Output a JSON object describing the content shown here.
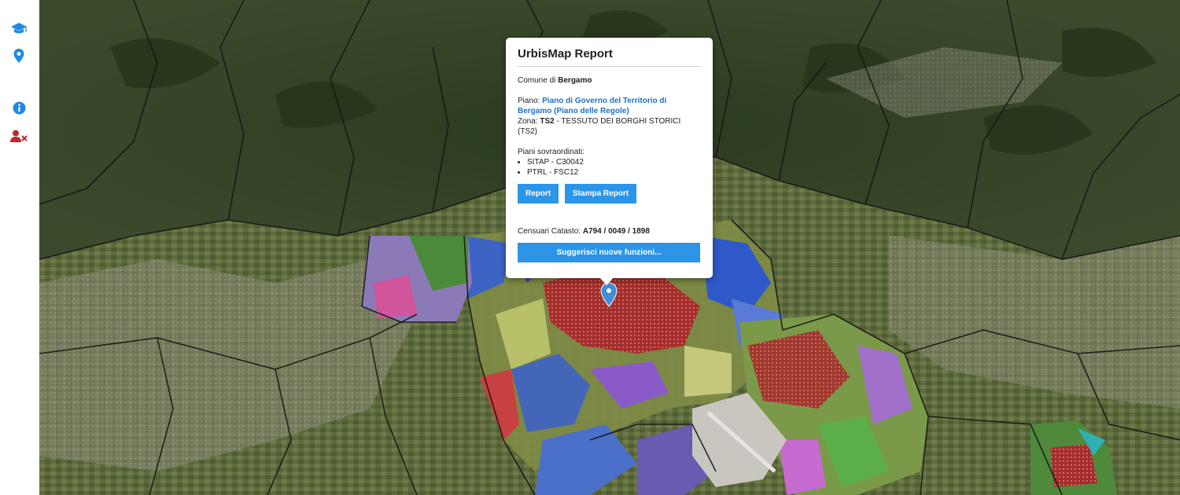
{
  "sidebar": {
    "items": [
      {
        "icon": "graduation-cap-icon",
        "color": "#1e88e5"
      },
      {
        "icon": "map-marker-icon",
        "color": "#1e88e5"
      },
      {
        "icon": "info-circle-icon",
        "color": "#1e88e5"
      },
      {
        "icon": "user-remove-icon",
        "color": "#c0282d"
      }
    ]
  },
  "popup": {
    "title": "UrbisMap Report",
    "comune_prefix": "Comune di",
    "comune_name": "Bergamo",
    "piano_label": "Piano:",
    "piano_link": "Piano di Governo del Territorio di Bergamo (Piano delle Regole)",
    "zona_label": "Zona:",
    "zona_code": "TS2",
    "zona_desc": "- TESSUTO DEI BORGHI STORICI (TS2)",
    "sovraordinati_label": "Piani sovraordinati:",
    "sovraordinati": [
      "SITAP - C30042",
      "PTRL - FSC12"
    ],
    "report_button": "Report",
    "stampa_button": "Stampa Report",
    "catasto_label": "Censuari Catasto:",
    "catasto_value": "A794 / 0049 / 1898",
    "suggest_button": "Suggerisci nuove funzioni..."
  },
  "colors": {
    "accent": "#2c95e8",
    "link": "#1a73c9",
    "marker": "#3f8fd8"
  }
}
